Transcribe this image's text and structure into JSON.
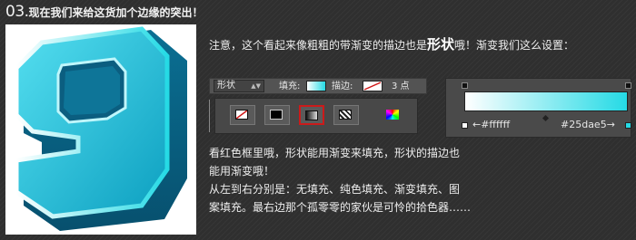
{
  "heading": {
    "number": "03.",
    "text": "现在我们来给这货加个边缘的突出！"
  },
  "intro": {
    "before": "注意，这个看起来像粗粗的带渐变的描边也是",
    "emph": "形状",
    "after": "哦！渐变我们这么设置："
  },
  "options_bar": {
    "mode_value": "形状",
    "fill_label": "填充:",
    "stroke_label": "描边:",
    "stroke_width": "3 点"
  },
  "fill_types": [
    {
      "name": "none-fill",
      "selected": false
    },
    {
      "name": "solid-fill",
      "selected": false
    },
    {
      "name": "gradient-fill",
      "selected": true
    },
    {
      "name": "pattern-fill",
      "selected": false
    },
    {
      "name": "color-picker",
      "selected": false
    }
  ],
  "gradient": {
    "start_label": "←#ffffff",
    "end_label": "#25dae5→",
    "start_color": "#ffffff",
    "end_color": "#25dae5"
  },
  "body": {
    "line1": "看红色框里哦，形状能用渐变来填充，形状的描边也",
    "line2": "能用渐变哦！",
    "line3": "从左到右分别是：无填充、纯色填充、渐变填充、图",
    "line4": "案填充。最右边那个孤零零的家伙是可怜的拾色器……"
  },
  "artwork": {
    "glyph": "9",
    "color": "#25dae5"
  }
}
